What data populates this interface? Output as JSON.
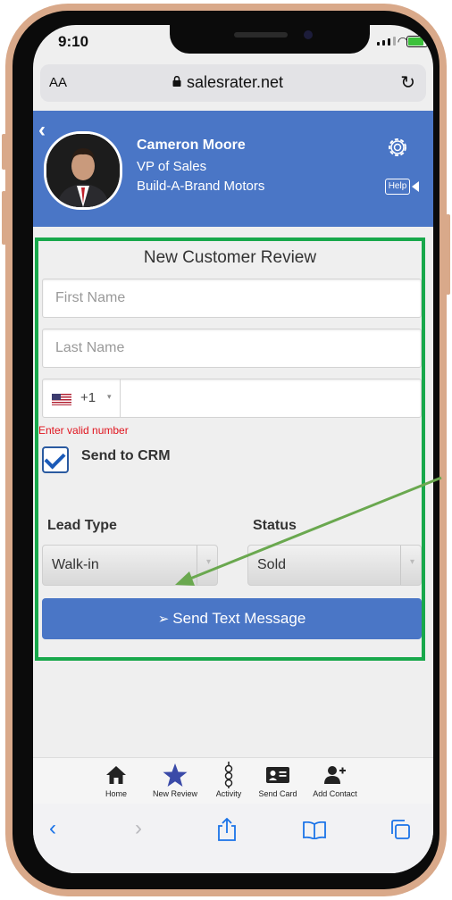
{
  "status_bar": {
    "time": "9:10"
  },
  "browser": {
    "text_size_label": "AA",
    "url": "salesrater.net"
  },
  "profile": {
    "name": "Cameron Moore",
    "title": "VP of Sales",
    "company": "Build-A-Brand Motors",
    "help_label": "Help"
  },
  "form": {
    "title": "New Customer Review",
    "first_name_placeholder": "First Name",
    "last_name_placeholder": "Last Name",
    "country_code": "+1",
    "phone_error": "Enter valid number",
    "send_to_crm_label": "Send to CRM",
    "send_to_crm_checked": true,
    "lead_type_label": "Lead Type",
    "lead_type_value": "Walk-in",
    "status_label": "Status",
    "status_value": "Sold",
    "send_button_label": "Send Text Message"
  },
  "bottom_nav": {
    "items": [
      {
        "label": "Home",
        "icon": "home-icon"
      },
      {
        "label": "New Review",
        "icon": "star-icon"
      },
      {
        "label": "Activity",
        "icon": "activity-icon"
      },
      {
        "label": "Send Card",
        "icon": "card-icon"
      },
      {
        "label": "Add Contact",
        "icon": "add-contact-icon"
      }
    ]
  },
  "colors": {
    "header_blue": "#4a76c6",
    "highlight_green": "#18a84b",
    "error_red": "#e0141e",
    "annotation_arrow": "#6aa84f"
  }
}
